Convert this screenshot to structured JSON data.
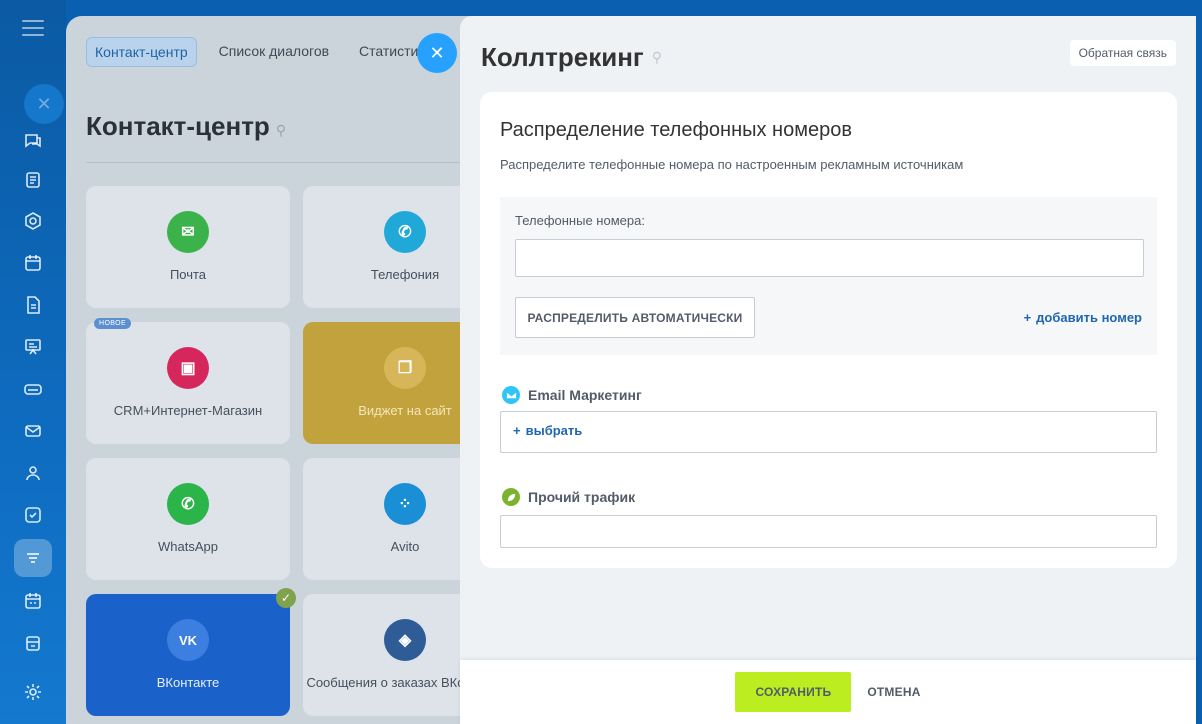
{
  "background": {
    "tabs": [
      "Контакт-центр",
      "Список диалогов",
      "Статисти"
    ],
    "new_top": "НОВОЕ",
    "title": "Контакт-центр",
    "tiles": [
      {
        "label": "Почта",
        "icon": "mail-icon",
        "color": "#3bb34a"
      },
      {
        "label": "Телефония",
        "icon": "phone-icon",
        "color": "#1fa8d8"
      },
      {
        "label": "CRM+Интернет-Магазин",
        "icon": "shop-icon",
        "color": "#d6275c",
        "badge": "НОВОЕ"
      },
      {
        "label": "Виджет на сайт",
        "icon": "chat-icon",
        "color": "#d7b659"
      },
      {
        "label": "WhatsApp",
        "icon": "whatsapp-icon",
        "color": "#2bb44a"
      },
      {
        "label": "Avito",
        "icon": "avito-icon",
        "color": "#1b8fd6"
      },
      {
        "label": "ВКонтакте",
        "icon": "vk-icon",
        "color": "#3d7fe0"
      },
      {
        "label": "Сообщения о заказах ВКонтакте",
        "icon": "vk-shop-icon",
        "color": "#2f5c96"
      }
    ]
  },
  "panel": {
    "title": "Коллтрекинг",
    "feedback": "Обратная связь",
    "heading": "Распределение телефонных номеров",
    "subtitle": "Распределите телефонные номера по настроенным рекламным источникам",
    "phones_label": "Телефонные номера:",
    "phones_value": "",
    "auto_button": "РАСПРЕДЕЛИТЬ АВТОМАТИЧЕСКИ",
    "add_number": "добавить номер",
    "sources": [
      {
        "name": "Email Маркетинг",
        "icon": "email-marketing-icon",
        "color": "#2fc6f6",
        "action": "выбрать"
      },
      {
        "name": "Прочий трафик",
        "icon": "leaf-icon",
        "color": "#7bb32e",
        "action": ""
      }
    ]
  },
  "footer": {
    "save": "СОХРАНИТЬ",
    "cancel": "ОТМЕНА"
  },
  "colors": {
    "accent_blue": "#2067b0",
    "save_green": "#bbed21",
    "close_blue": "#27a1ff"
  }
}
